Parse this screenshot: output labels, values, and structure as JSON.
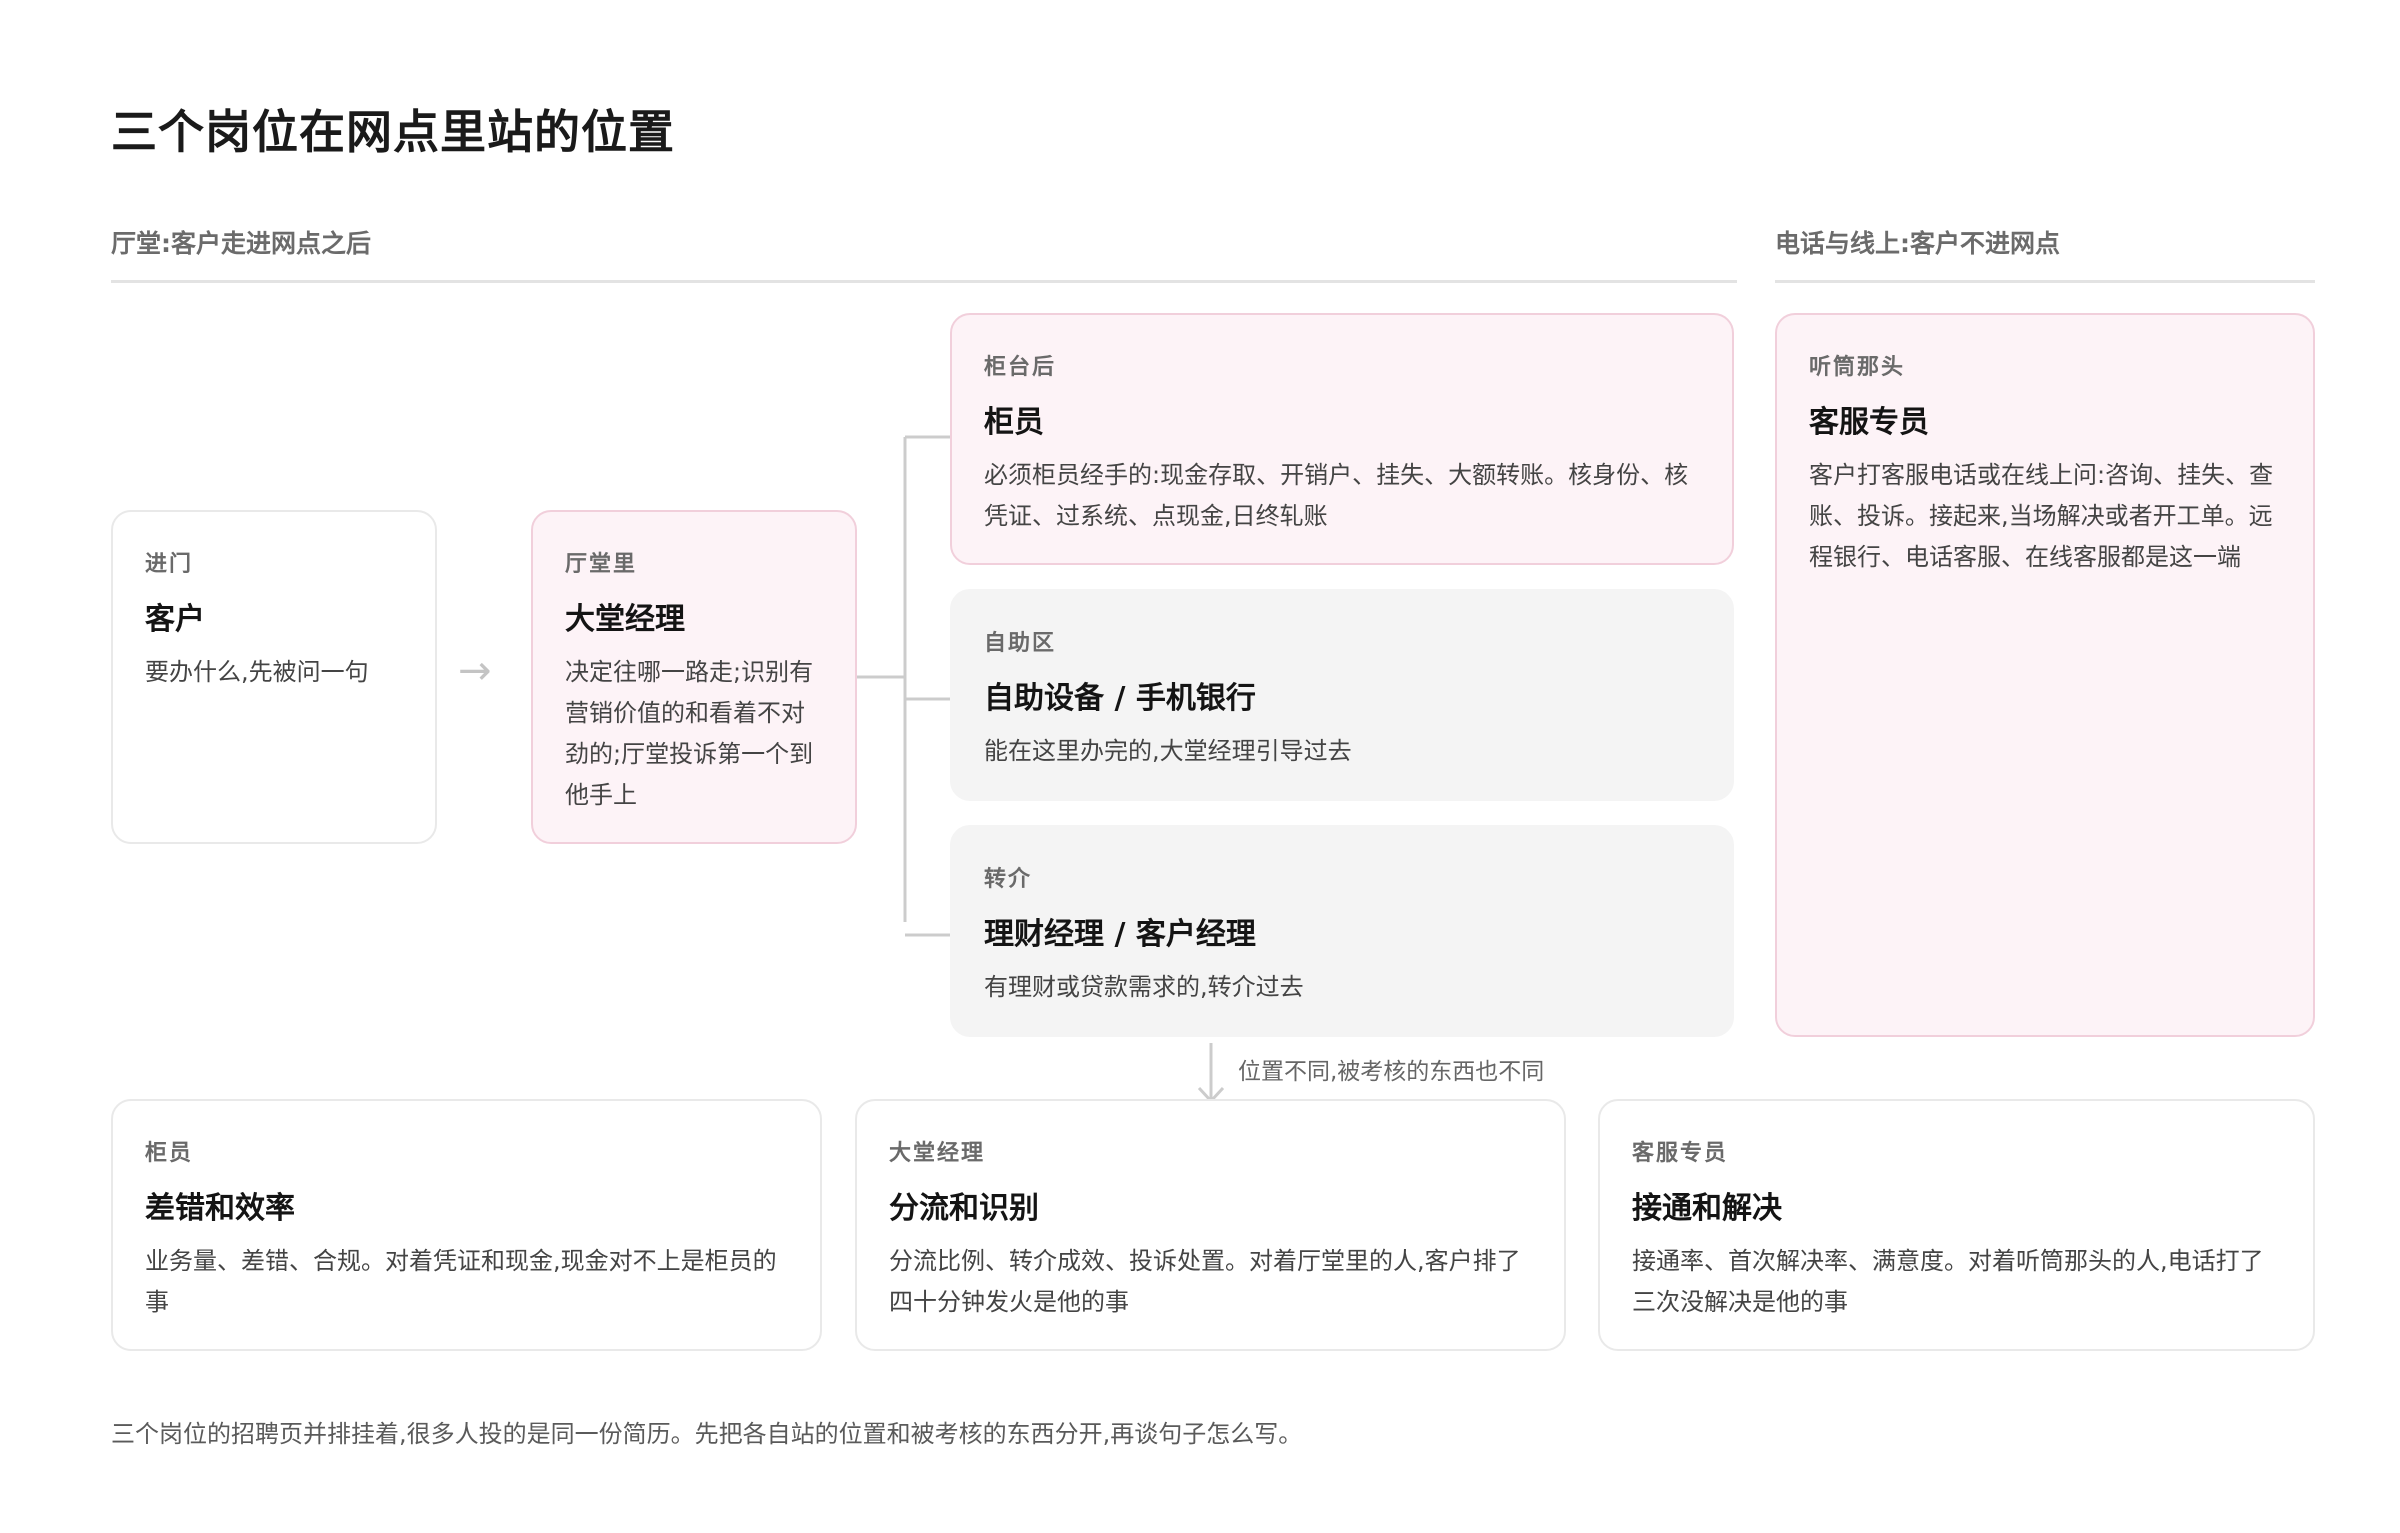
{
  "title": "三个岗位在网点里站的位置",
  "sections": {
    "hall": "厅堂:客户走进网点之后",
    "remote": "电话与线上:客户不进网点"
  },
  "flow": {
    "customer": {
      "eyebrow": "进门",
      "title": "客户",
      "desc": "要办什么,先被问一句"
    },
    "arrow_icon": "→",
    "lobby_manager": {
      "eyebrow": "厅堂里",
      "title": "大堂经理",
      "desc": "决定往哪一路走;识别有营销价值的和看着不对劲的;厅堂投诉第一个到他手上"
    },
    "teller": {
      "eyebrow": "柜台后",
      "title": "柜员",
      "desc": "必须柜员经手的:现金存取、开销户、挂失、大额转账。核身份、核凭证、过系统、点现金,日终轧账"
    },
    "self_service": {
      "eyebrow": "自助区",
      "title": "自助设备 / 手机银行",
      "desc": "能在这里办完的,大堂经理引导过去"
    },
    "referral": {
      "eyebrow": "转介",
      "title": "理财经理 / 客户经理",
      "desc": "有理财或贷款需求的,转介过去"
    },
    "service_rep": {
      "eyebrow": "听筒那头",
      "title": "客服专员",
      "desc": "客户打客服电话或在线上问:咨询、挂失、查账、投诉。接起来,当场解决或者开工单。远程银行、电话客服、在线客服都是这一端"
    }
  },
  "transition_note": "位置不同,被考核的东西也不同",
  "kpis": [
    {
      "eyebrow": "柜员",
      "title": "差错和效率",
      "desc": "业务量、差错、合规。对着凭证和现金,现金对不上是柜员的事"
    },
    {
      "eyebrow": "大堂经理",
      "title": "分流和识别",
      "desc": "分流比例、转介成效、投诉处置。对着厅堂里的人,客户排了四十分钟发火是他的事"
    },
    {
      "eyebrow": "客服专员",
      "title": "接通和解决",
      "desc": "接通率、首次解决率、满意度。对着听筒那头的人,电话打了三次没解决是他的事"
    }
  ],
  "footer": "三个岗位的招聘页并排挂着,很多人投的是同一份简历。先把各自站的位置和被考核的东西分开,再谈句子怎么写。",
  "colors": {
    "pink_fill": "#fdf3f7",
    "pink_border": "#f1cfdb",
    "grey_fill": "#f4f4f4",
    "connector": "#cccccc"
  }
}
